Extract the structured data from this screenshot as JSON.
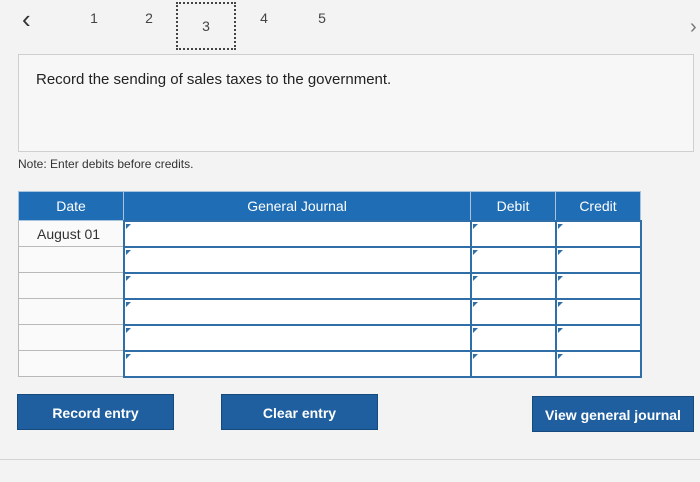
{
  "pager": {
    "prev_icon": "‹",
    "next_icon": "›",
    "pages": [
      "1",
      "2",
      "3",
      "4",
      "5"
    ],
    "active_page": "3"
  },
  "prompt": {
    "text": "Record the sending of sales taxes to the government."
  },
  "note": {
    "text": "Note: Enter debits before credits."
  },
  "journal": {
    "headers": {
      "date": "Date",
      "general_journal": "General Journal",
      "debit": "Debit",
      "credit": "Credit"
    },
    "rows": [
      {
        "date": "August 01",
        "account": "",
        "debit": "",
        "credit": ""
      },
      {
        "date": "",
        "account": "",
        "debit": "",
        "credit": ""
      },
      {
        "date": "",
        "account": "",
        "debit": "",
        "credit": ""
      },
      {
        "date": "",
        "account": "",
        "debit": "",
        "credit": ""
      },
      {
        "date": "",
        "account": "",
        "debit": "",
        "credit": ""
      },
      {
        "date": "",
        "account": "",
        "debit": "",
        "credit": ""
      }
    ]
  },
  "buttons": {
    "record_entry": "Record entry",
    "clear_entry": "Clear entry",
    "view_general_journal": "View general journal"
  }
}
